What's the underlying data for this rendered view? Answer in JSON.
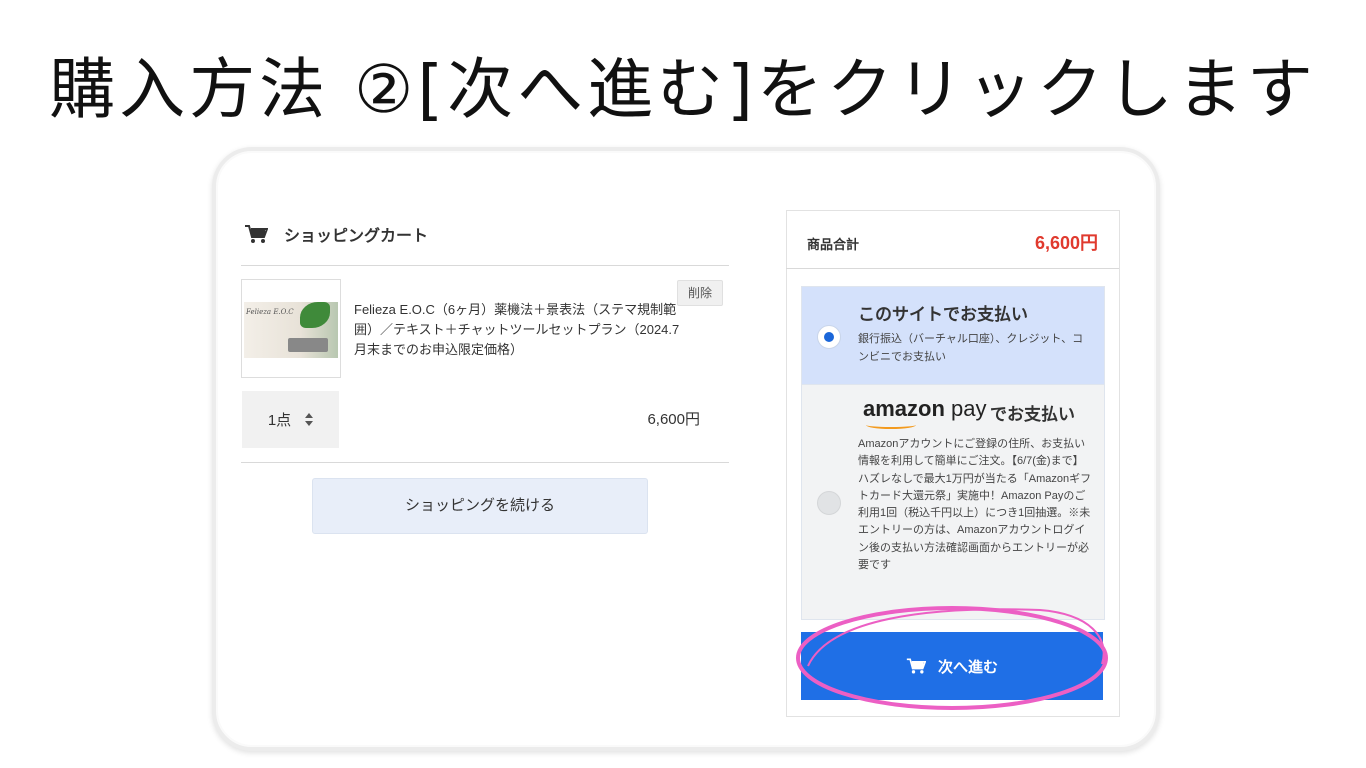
{
  "headline": "購入方法 ②[次へ進む]をクリックします",
  "cart": {
    "title": "ショッピングカート",
    "item": {
      "thumbnail_text": "Felieza E.O.C",
      "title": "Felieza E.O.C（6ヶ月）薬機法＋景表法（ステマ規制範囲）／テキスト＋チャットツールセットプラン（2024.7月末までのお申込限定価格）",
      "delete_label": "削除",
      "quantity": "1点",
      "price": "6,600円"
    },
    "continue_label": "ショッピングを続ける"
  },
  "summary": {
    "subtotal_label": "商品合計",
    "subtotal_value": "6,600円",
    "payment_options": [
      {
        "title": "このサイトでお支払い",
        "description": "銀行振込（バーチャル口座）、クレジット、コンビニでお支払い",
        "selected": true
      },
      {
        "logo_text_1": "amazon",
        "logo_text_2": " pay",
        "title_suffix": "でお支払い",
        "description": "Amazonアカウントにご登録の住所、お支払い情報を利用して簡単にご注文。【6/7(金)まで】ハズレなしで最大1万円が当たる「Amazonギフトカード大還元祭」実施中！Amazon Payのご利用1回（税込千円以上）につき1回抽選。※未エントリーの方は、Amazonアカウントログイン後の支払い方法確認画面からエントリーが必要です",
        "selected": false
      }
    ],
    "next_label": "次へ進む"
  },
  "colors": {
    "accent_blue": "#1f6fe6",
    "price_red": "#e03a2e",
    "highlight_pink": "#ec5fc4",
    "amazon_orange": "#f39a1e"
  },
  "icons": [
    "cart-icon",
    "cart-icon-white",
    "radio-selected-icon",
    "radio-unselected-icon",
    "sort-arrows-icon"
  ]
}
